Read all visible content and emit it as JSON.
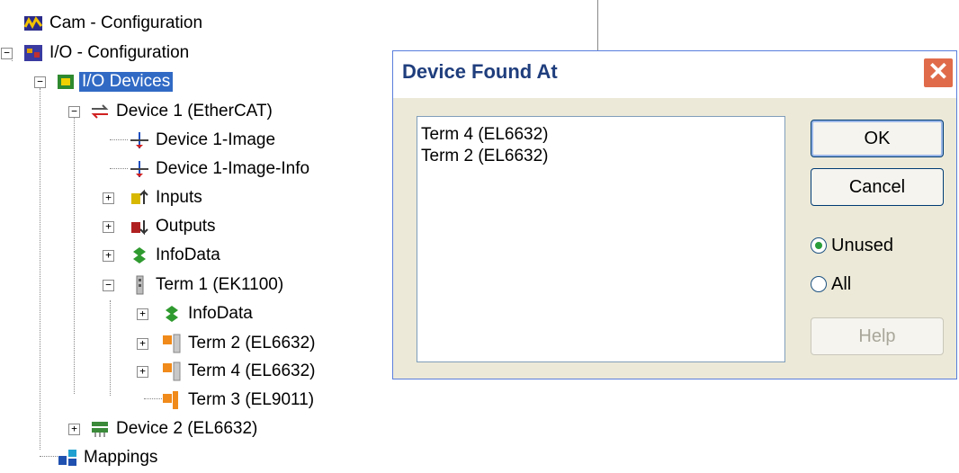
{
  "tree": {
    "cam_config": "Cam - Configuration",
    "io_config": "I/O - Configuration",
    "io_devices": "I/O Devices",
    "device1": "Device 1 (EtherCAT)",
    "device1_image": "Device 1-Image",
    "device1_image_info": "Device 1-Image-Info",
    "inputs": "Inputs",
    "outputs": "Outputs",
    "infodata": "InfoData",
    "term1": "Term 1 (EK1100)",
    "term1_infodata": "InfoData",
    "term2": "Term 2 (EL6632)",
    "term4": "Term 4 (EL6632)",
    "term3": "Term 3 (EL9011)",
    "device2": "Device 2 (EL6632)",
    "mappings": "Mappings"
  },
  "dialog": {
    "title": "Device Found At",
    "close": "✕",
    "list": [
      "Term 4 (EL6632)",
      "Term 2 (EL6632)"
    ],
    "ok": "OK",
    "cancel": "Cancel",
    "radio_unused": "Unused",
    "radio_all": "All",
    "help": "Help"
  }
}
